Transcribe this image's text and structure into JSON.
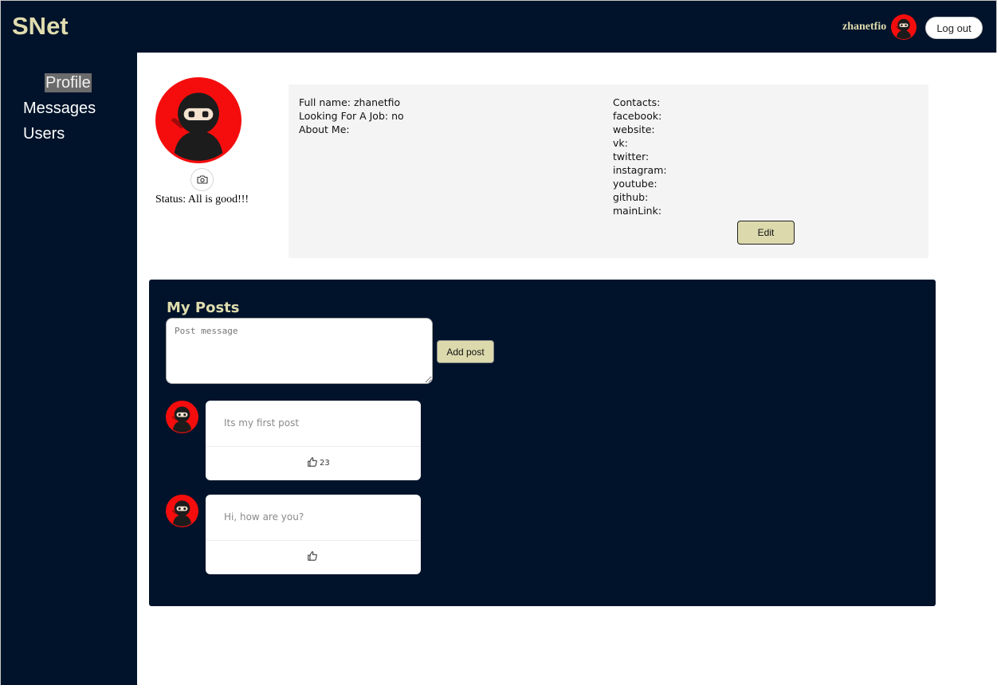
{
  "header": {
    "logo": "SNet",
    "login_name": "zhanetfio",
    "logout_label": "Log out"
  },
  "sidebar": {
    "items": [
      {
        "label": "Profile",
        "active": true
      },
      {
        "label": "Messages",
        "active": false
      },
      {
        "label": "Users",
        "active": false
      }
    ]
  },
  "profile": {
    "status_label": "Status: All is good!!!",
    "full_name_line": "Full name: zhanetfio",
    "looking_for_job_line": "Looking For A Job: no",
    "about_me_line": "About Me:",
    "contacts_title": "Contacts:",
    "contacts": [
      "facebook:",
      "website:",
      "vk:",
      "twitter:",
      "instagram:",
      "youtube:",
      "github:",
      "mainLink:"
    ],
    "edit_label": "Edit"
  },
  "posts": {
    "title": "My Posts",
    "textarea_placeholder": "Post message",
    "add_post_label": "Add post",
    "items": [
      {
        "text": "Its my first post",
        "likes": "23"
      },
      {
        "text": "Hi, how are you?",
        "likes": ""
      }
    ]
  },
  "colors": {
    "dark_navy": "#00132a",
    "accent_khaki": "#dcd9ad",
    "logo_text": "#e0dcae",
    "avatar_red": "#f50d0d"
  },
  "icons": {
    "avatar": "ninja-avatar-icon",
    "camera": "camera-icon",
    "like": "thumbs-up-icon"
  }
}
